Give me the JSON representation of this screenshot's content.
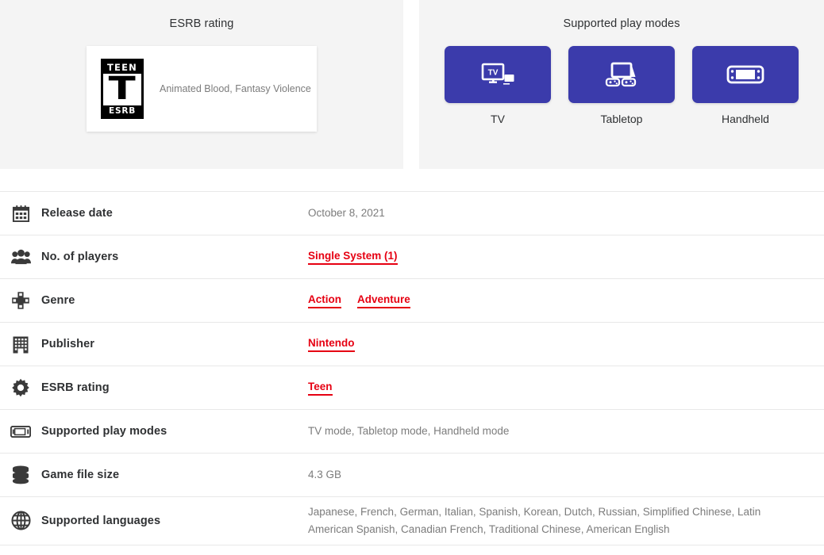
{
  "esrb_panel": {
    "title": "ESRB rating",
    "badge": {
      "top_text": "TEEN",
      "letter": "T",
      "bottom_text": "ESRB"
    },
    "descriptors": "Animated Blood, Fantasy Violence"
  },
  "play_modes_panel": {
    "title": "Supported play modes",
    "modes": [
      {
        "label": "TV",
        "icon": "tv-icon"
      },
      {
        "label": "Tabletop",
        "icon": "tabletop-icon"
      },
      {
        "label": "Handheld",
        "icon": "handheld-icon"
      }
    ],
    "tile_color": "#3b3bab"
  },
  "details": {
    "rows": [
      {
        "icon": "calendar-icon",
        "label": "Release date",
        "value": "October 8, 2021",
        "type": "text"
      },
      {
        "icon": "players-icon",
        "label": "No. of players",
        "type": "links",
        "links": [
          "Single System (1)"
        ]
      },
      {
        "icon": "dpad-icon",
        "label": "Genre",
        "type": "links",
        "links": [
          "Action",
          "Adventure"
        ]
      },
      {
        "icon": "building-icon",
        "label": "Publisher",
        "type": "links",
        "links": [
          "Nintendo"
        ]
      },
      {
        "icon": "gear-icon",
        "label": "ESRB rating",
        "type": "links",
        "links": [
          "Teen"
        ]
      },
      {
        "icon": "handheld-device-icon",
        "label": "Supported play modes",
        "value": "TV mode, Tabletop mode, Handheld mode",
        "type": "text"
      },
      {
        "icon": "database-icon",
        "label": "Game file size",
        "value": "4.3 GB",
        "type": "text"
      },
      {
        "icon": "globe-icon",
        "label": "Supported languages",
        "value": "Japanese, French, German, Italian, Spanish, Korean, Dutch, Russian, Simplified Chinese, Latin American Spanish, Canadian French, Traditional Chinese, American English",
        "type": "text"
      }
    ]
  },
  "colors": {
    "link_red": "#e60012",
    "panel_bg": "#f4f4f4",
    "value_gray": "#7c7c7c",
    "label_dark": "#2f3133"
  }
}
